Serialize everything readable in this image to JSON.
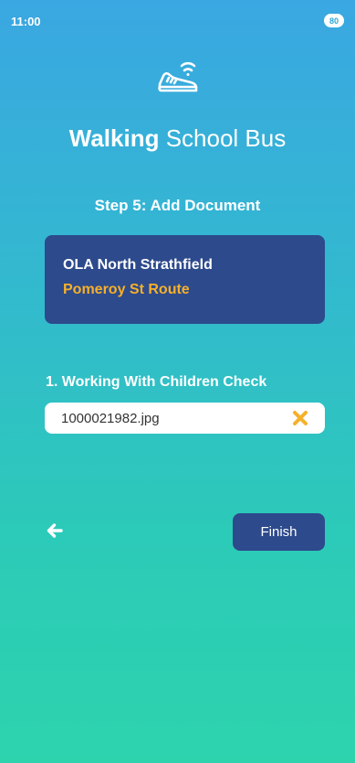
{
  "status_bar": {
    "time": "11:00",
    "battery": "80"
  },
  "header": {
    "logo_icon": "walking-shoe-wifi-icon",
    "title_bold": "Walking",
    "title_rest": " School Bus"
  },
  "step": {
    "title": "Step 5: Add Document"
  },
  "route_card": {
    "school": "OLA North Strathfield",
    "route": "Pomeroy St Route",
    "route_color": "#f6b02a",
    "background": "#2d4a8c"
  },
  "documents": [
    {
      "label": "1. Working With Children Check",
      "file_name": "1000021982.jpg",
      "remove_icon": "close-x-icon"
    }
  ],
  "nav": {
    "back_icon": "arrow-left-icon",
    "finish_label": "Finish"
  }
}
